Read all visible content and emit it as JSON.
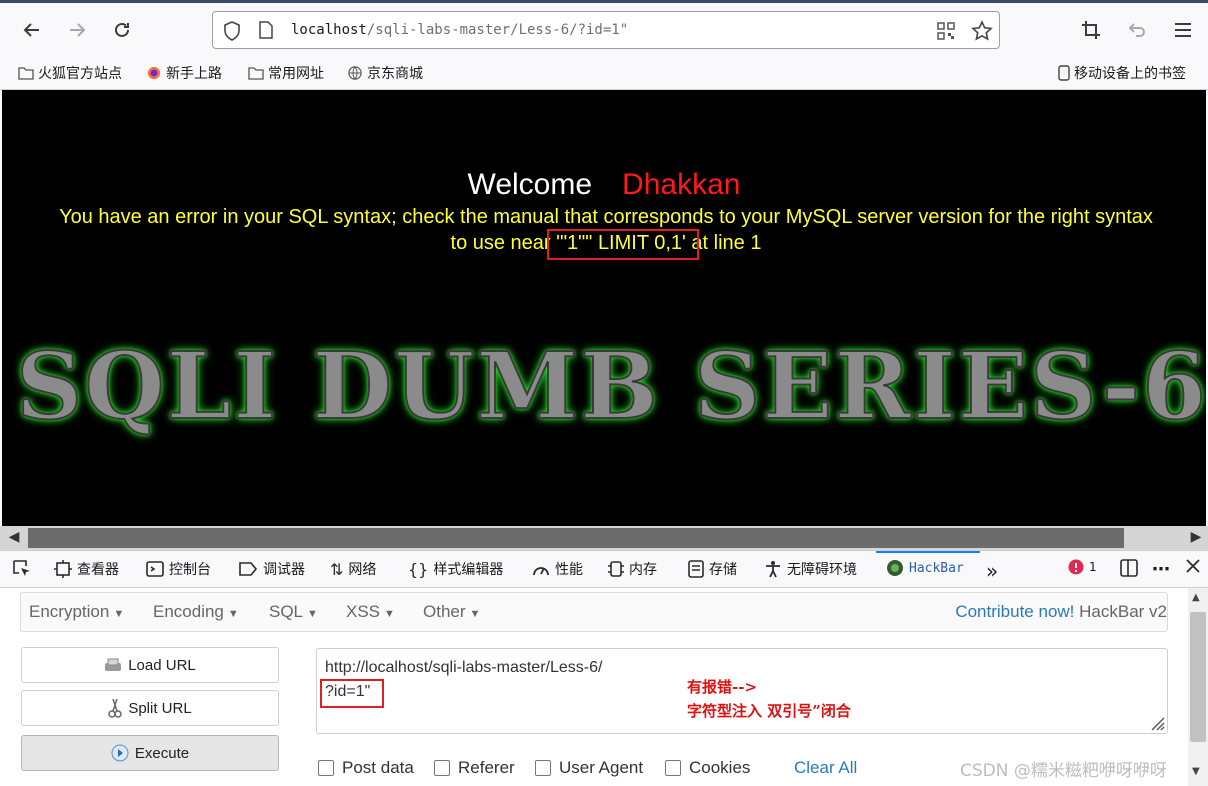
{
  "browser": {
    "url_host": "localhost",
    "url_path": "/sqli-labs-master/Less-6/?id=1\"",
    "bookmarks": [
      "火狐官方站点",
      "新手上路",
      "常用网址",
      "京东商城"
    ],
    "mobile_bookmarks": "移动设备上的书签"
  },
  "page": {
    "welcome": "Welcome",
    "name": "Dhakkan",
    "error_line1": "You have an error in your SQL syntax; check the manual that corresponds to your MySQL server version for the right syntax",
    "error_prefix": "to use near ",
    "error_highlight": "'\"1\"\" LIMIT 0,1'",
    "error_suffix": " at line 1",
    "banner": "SQLI DUMB SERIES-6"
  },
  "devtools": {
    "tabs": [
      "查看器",
      "控制台",
      "调试器",
      "网络",
      "样式编辑器",
      "性能",
      "内存",
      "存储",
      "无障碍环境",
      "HackBar"
    ],
    "error_count": "1"
  },
  "hackbar": {
    "menus": [
      "Encryption",
      "Encoding",
      "SQL",
      "XSS",
      "Other"
    ],
    "contribute": "Contribute now!",
    "version": " HackBar v2",
    "load_url": "Load URL",
    "split_url": "Split URL",
    "execute": "Execute",
    "url_line1": "http://localhost/sqli-labs-master/Less-6/",
    "url_line2": "?id=1\"",
    "note_line1": "有报错-->",
    "note_line2": "字符型注入   双引号”闭合",
    "options": [
      "Post data",
      "Referer",
      "User Agent",
      "Cookies"
    ],
    "clear_all": "Clear All"
  },
  "watermark": "CSDN @糯米糍粑咿呀咿呀"
}
